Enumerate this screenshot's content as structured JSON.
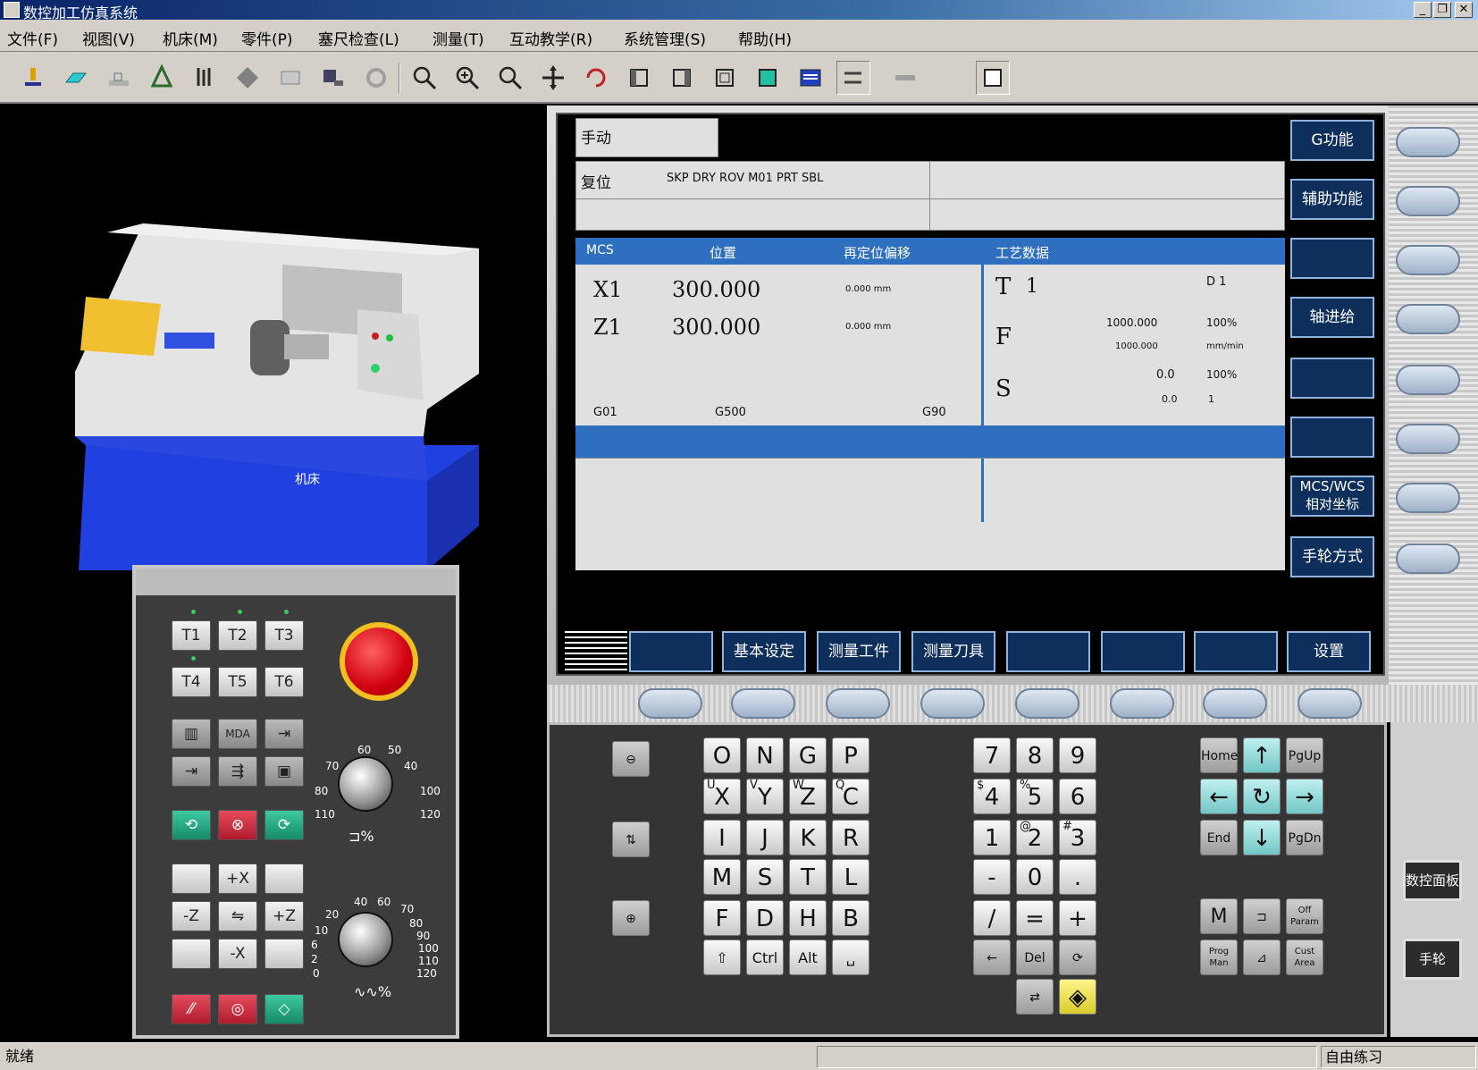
{
  "window": {
    "title": "数控加工仿真系统"
  },
  "menu": [
    "文件(F)",
    "视图(V)",
    "机床(M)",
    "零件(P)",
    "塞尺检查(L)",
    "测量(T)",
    "互动教学(R)",
    "系统管理(S)",
    "帮助(H)"
  ],
  "toolbar_icons": [
    "machine-select-icon",
    "blank-define-icon",
    "place-part-icon",
    "tool-select-icon",
    "coordinate-icon",
    "move-icon",
    "reset-icon",
    "measure-icon",
    "settings-icon",
    "zoom-in-icon",
    "zoom-plus-icon",
    "zoom-out-icon",
    "pan-icon",
    "rotate-icon",
    "left-view-icon",
    "right-view-icon",
    "front-view-icon",
    "top-view-icon",
    "panel-view-icon",
    "switch-icon",
    "tool-mount-icon",
    "window-icon"
  ],
  "view3d": {
    "machine_label": "机床"
  },
  "cnc_screen": {
    "mode": "手动",
    "status": "复位",
    "flags": "SKP  DRY  ROV  M01  PRT  SBL",
    "pos_header": {
      "mcs": "MCS",
      "position": "位置",
      "offset": "再定位偏移",
      "process": "工艺数据"
    },
    "axes": [
      {
        "name": "X1",
        "value": "300.000",
        "offset": "0.000 mm"
      },
      {
        "name": "Z1",
        "value": "300.000",
        "offset": "0.000 mm"
      }
    ],
    "footer_row": {
      "left": "G01",
      "mid": "G500",
      "right": "G90"
    },
    "tool": {
      "label": "T",
      "value": "1",
      "d": "D 1"
    },
    "feed": {
      "label": "F",
      "val1": "1000.000",
      "pct1": "100%",
      "val2": "1000.000",
      "unit": "mm/min"
    },
    "spindle": {
      "label": "S",
      "val1": "0.0",
      "pct1": "100%",
      "val2": "0.0",
      "num": "1"
    },
    "softkeys_v": [
      "G功能",
      "辅助功能",
      "",
      "轴进给",
      "",
      "",
      "MCS/WCS 相对坐标",
      "手轮方式"
    ],
    "softkeys_h": [
      "",
      "基本设定",
      "测量工件",
      "测量刀具",
      "",
      "",
      "",
      "设置"
    ]
  },
  "machine_panel": {
    "tool_keys": [
      "T1",
      "T2",
      "T3",
      "T4",
      "T5",
      "T6"
    ],
    "jog_keys": [
      "",
      "+X",
      "",
      "-Z",
      "⇋",
      "+Z",
      "",
      "-X",
      ""
    ],
    "dial1_label": "%",
    "dial2_label": "%",
    "dial1_ticks": [
      "60",
      "50",
      "70",
      "40",
      "80",
      "100",
      "110",
      "120"
    ],
    "dial2_ticks": [
      "40",
      "60",
      "70",
      "20",
      "80",
      "10",
      "90",
      "6",
      "100",
      "2",
      "110",
      "0",
      "120"
    ]
  },
  "keyboard": {
    "alpha": [
      [
        [
          "",
          "O"
        ],
        [
          "",
          "N"
        ],
        [
          "",
          "G"
        ],
        [
          "",
          "P"
        ]
      ],
      [
        [
          "U",
          "X"
        ],
        [
          "V",
          "Y"
        ],
        [
          "W",
          "Z"
        ],
        [
          "Q",
          "C"
        ]
      ],
      [
        [
          "",
          "I"
        ],
        [
          "",
          "J"
        ],
        [
          "",
          "K"
        ],
        [
          "",
          "R"
        ]
      ],
      [
        [
          "",
          "M"
        ],
        [
          "",
          "S"
        ],
        [
          "",
          "T"
        ],
        [
          "",
          "L"
        ]
      ],
      [
        [
          "",
          "F"
        ],
        [
          "",
          "D"
        ],
        [
          "",
          "H"
        ],
        [
          "",
          "B"
        ]
      ]
    ],
    "alpha_mods": [
      "⇧",
      "Ctrl",
      "Alt",
      "␣"
    ],
    "numeric": [
      [
        [
          "",
          "7"
        ],
        [
          "",
          "8"
        ],
        [
          "",
          "9"
        ]
      ],
      [
        [
          "$",
          "4"
        ],
        [
          "%",
          "5"
        ],
        [
          "",
          "6"
        ]
      ],
      [
        [
          "",
          "1"
        ],
        [
          "@",
          "2"
        ],
        [
          "#",
          "3"
        ]
      ],
      [
        [
          "",
          "-"
        ],
        [
          "",
          "0"
        ],
        [
          "",
          ". "
        ]
      ],
      [
        [
          "",
          "/"
        ],
        [
          "",
          "="
        ],
        [
          "",
          "+"
        ]
      ]
    ],
    "num_mods": [
      "←",
      "Del",
      "⟳"
    ],
    "nav": [
      "Home",
      "↑",
      "PgUp",
      "←",
      "↻",
      "→",
      "End",
      "↓",
      "PgDn"
    ],
    "func": [
      "M",
      "⊐",
      "Off Param",
      "Prog Man",
      "⊿",
      "Cust Area"
    ],
    "side_buttons": [
      "数控面板",
      "手轮"
    ]
  },
  "statusbar": {
    "left": "就绪",
    "right": "自由练习"
  }
}
